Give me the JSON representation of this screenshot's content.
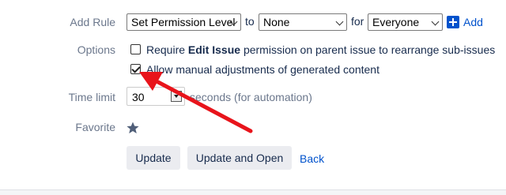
{
  "add_rule": {
    "label": "Add Rule",
    "permission_select": "Set Permission Level",
    "to_word": "to",
    "level_select": "None",
    "for_word": "for",
    "audience_select": "Everyone",
    "add_link": "Add"
  },
  "options": {
    "label": "Options",
    "require_prefix": "Require ",
    "require_bold": "Edit Issue",
    "require_suffix": " permission on parent issue to rearrange sub-issues",
    "require_checked": false,
    "manual_label": "Allow manual adjustments of generated content",
    "manual_checked": true
  },
  "time_limit": {
    "label": "Time limit",
    "value": "30",
    "suffix": "seconds (for automation)"
  },
  "favorite": {
    "label": "Favorite",
    "icon": "star-icon"
  },
  "actions": {
    "update": "Update",
    "update_and_open": "Update and Open",
    "back": "Back"
  },
  "annotation": {
    "arrow_color": "#e8141b"
  },
  "colors": {
    "link": "#0052cc",
    "label": "#6b778c",
    "button_bg": "#ebecf0"
  }
}
